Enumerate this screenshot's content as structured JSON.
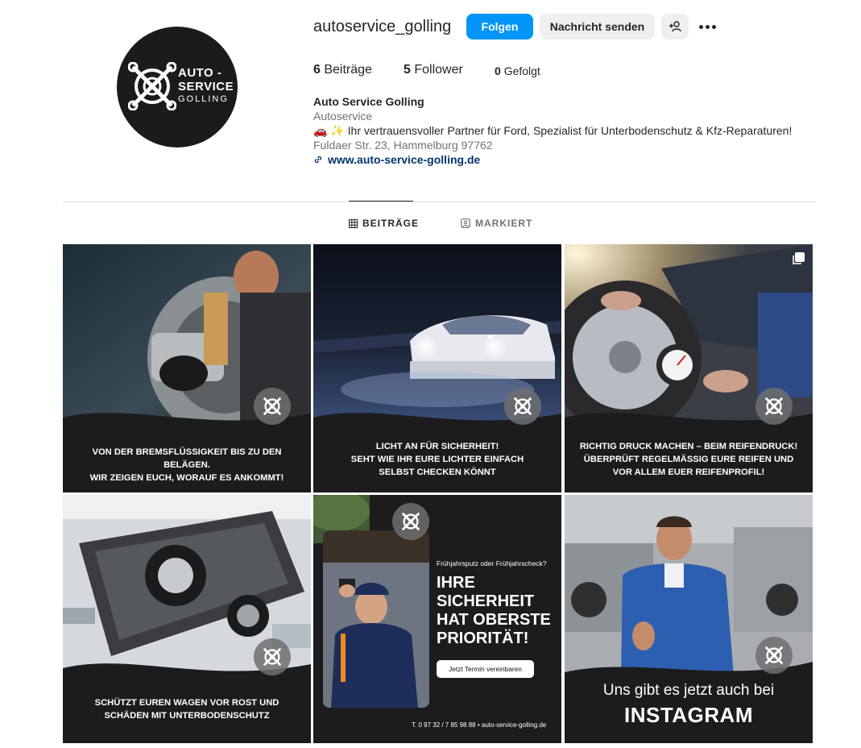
{
  "profile": {
    "username": "autoservice_golling",
    "follow_label": "Folgen",
    "message_label": "Nachricht senden",
    "avatar_logo": {
      "line1": "AUTO -",
      "line2": "SERVICE",
      "line3": "GOLLING"
    },
    "stats": {
      "posts_count": "6",
      "posts_label": "Beiträge",
      "followers_count": "5",
      "followers_label": "Follower",
      "following_count": "0",
      "following_label": "Gefolgt"
    },
    "bio": {
      "name": "Auto Service Golling",
      "category": "Autoservice",
      "description": "🚗 ✨ Ihr vertrauensvoller Partner für Ford, Spezialist für Unterbodenschutz & Kfz-Reparaturen!",
      "address": "Fuldaer Str. 23, Hammelburg 97762",
      "website": "www.auto-service-golling.de"
    }
  },
  "tabs": {
    "posts": "BEITRÄGE",
    "tagged": "MARKIERT"
  },
  "posts": [
    {
      "caption_line1": "VON DER BREMSFLÜSSIGKEIT BIS ZU DEN BELÄGEN.",
      "caption_line2": "WIR ZEIGEN EUCH, WORAUF ES ANKOMMT!",
      "caption_line3": ""
    },
    {
      "caption_line1": "LICHT AN FÜR SICHERHEIT!",
      "caption_line2": "SEHT WIE IHR EURE LICHTER EINFACH",
      "caption_line3": "SELBST CHECKEN KÖNNT"
    },
    {
      "caption_line1": "RICHTIG DRUCK MACHEN – BEIM REIFENDRUCK!",
      "caption_line2": "ÜBERPRÜFT REGELMÄSSIG EURE REIFEN UND",
      "caption_line3": "VOR ALLEM EUER REIFENPROFIL!"
    },
    {
      "caption_line1": "SCHÜTZT EUREN WAGEN VOR ROST UND",
      "caption_line2": "SCHÄDEN MIT UNTERBODENSCHUTZ",
      "caption_line3": ""
    },
    {
      "small_question": "Frühjahrsputz oder Frühjahrscheck?",
      "title_line1": "IHRE",
      "title_line2": "SICHERHEIT",
      "title_line3": "HAT OBERSTE",
      "title_line4": "PRIORITÄT!",
      "cta": "Jetzt Termin vereinbaren",
      "contact": "T. 0 97 32 / 7 85 98 88 • auto-service-golling.de"
    },
    {
      "promo_sub": "Uns gibt es jetzt auch bei",
      "promo_main": "INSTAGRAM"
    }
  ],
  "colors": {
    "primary_button": "#0095f6",
    "secondary_button": "#efefef",
    "link": "#00376b",
    "post_background": "#1c1c1e"
  },
  "icons": [
    "add-user-icon",
    "more-options-icon",
    "link-icon",
    "grid-icon",
    "tagged-icon",
    "carousel-icon",
    "wheel-wrench-logo-icon"
  ]
}
